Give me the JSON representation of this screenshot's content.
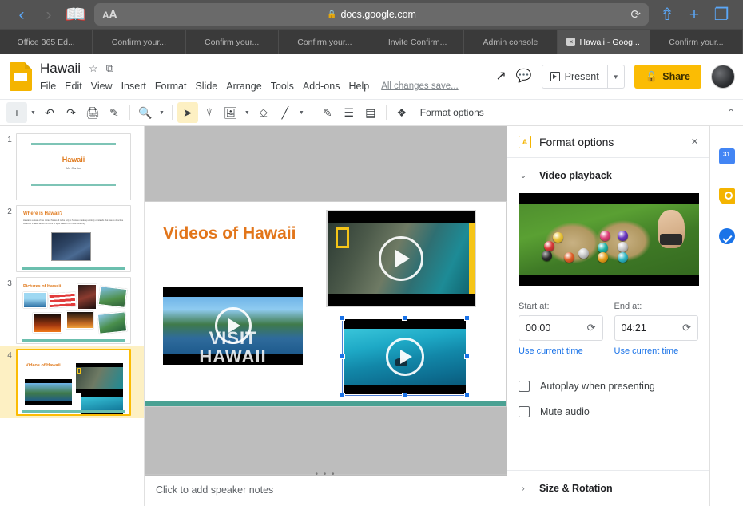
{
  "browser": {
    "back_icon": "chevron-left",
    "forward_icon": "chevron-right",
    "bookmarks_icon": "book",
    "reader_label": "AA",
    "url": "docs.google.com",
    "lock_icon": "lock",
    "reload_icon": "reload",
    "share_icon": "share-up",
    "newtab_icon": "plus",
    "tabs_icon": "tabs",
    "tabs": [
      {
        "label": "Office 365 Ed...",
        "active": false,
        "has_close": false
      },
      {
        "label": "Confirm your...",
        "active": false,
        "has_close": false
      },
      {
        "label": "Confirm your...",
        "active": false,
        "has_close": false
      },
      {
        "label": "Confirm your...",
        "active": false,
        "has_close": false
      },
      {
        "label": "Invite Confirm...",
        "active": false,
        "has_close": false
      },
      {
        "label": "Admin console",
        "active": false,
        "has_close": false
      },
      {
        "label": "Hawaii - Goog...",
        "active": true,
        "has_close": true,
        "close_glyph": "×"
      },
      {
        "label": "Confirm your...",
        "active": false,
        "has_close": false
      }
    ]
  },
  "app": {
    "logo": "google-slides-logo",
    "doc_title": "Hawaii",
    "star_icon": "☆",
    "move_icon": "⧉",
    "menus": [
      "File",
      "Edit",
      "View",
      "Insert",
      "Format",
      "Slide",
      "Arrange",
      "Tools",
      "Add-ons",
      "Help"
    ],
    "save_state": "All changes save...",
    "activity_icon": "trending-up-icon",
    "comments_icon": "comment-icon",
    "present_label": "Present",
    "present_caret": "▼",
    "share_label": "Share",
    "avatar": "user-avatar"
  },
  "toolbar": {
    "new_slide_icon": "+",
    "new_slide_caret": "▼",
    "undo_icon": "↶",
    "redo_icon": "↷",
    "print_icon": "⎙",
    "paint_format_icon": "✐",
    "zoom_icon": "⌕",
    "zoom_caret": "▼",
    "select_icon": "➤",
    "textbox_icon": "T",
    "image_icon": "▣",
    "image_caret": "▼",
    "shape_icon": "◯",
    "line_icon": "╲",
    "line_caret": "▼",
    "pen_icon": "✎",
    "align_icon": "≡",
    "layout_icon": "☷",
    "transition_icon": "✦",
    "format_options_label": "Format options",
    "collapse_icon": "⌃"
  },
  "filmstrip": {
    "slides": [
      {
        "number": "1",
        "title": "Hawaii",
        "subtitle": "Mr. Cantor",
        "current": false
      },
      {
        "number": "2",
        "title": "Where is Hawaii?",
        "current": false
      },
      {
        "number": "3",
        "title": "Pictures of Hawaii",
        "current": false
      },
      {
        "number": "4",
        "title": "Videos of Hawaii",
        "current": true
      }
    ]
  },
  "slide": {
    "title": "Videos of Hawaii",
    "video1_overlay": "VISIT\nHAWAII",
    "video1_name": "visit-hawaii-video",
    "video2_name": "national-geographic-video",
    "video3_name": "surfing-video-selected"
  },
  "notes": {
    "grip_icon": "• • •",
    "placeholder": "Click to add speaker notes"
  },
  "format_panel": {
    "panel_icon": "format-options-icon",
    "title": "Format options",
    "close_icon": "×",
    "sections": [
      {
        "label": "Video playback",
        "expanded": true,
        "chevron": "⌄"
      },
      {
        "label": "Size & Rotation",
        "expanded": false,
        "chevron": "›"
      }
    ],
    "preview_name": "video-thumbnail-preview",
    "start_label": "Start at:",
    "start_value": "00:00",
    "end_label": "End at:",
    "end_value": "04:21",
    "refresh_icon": "⟳",
    "use_current_time": "Use current time",
    "autoplay_label": "Autoplay when presenting",
    "autoplay_checked": false,
    "mute_label": "Mute audio",
    "mute_checked": false
  },
  "right_rail": {
    "items": [
      {
        "name": "google-calendar-icon"
      },
      {
        "name": "google-keep-icon"
      },
      {
        "name": "google-tasks-icon"
      }
    ]
  },
  "colors": {
    "slides_yellow": "#f4b400",
    "share_yellow": "#fbbc04",
    "title_orange": "#e2751a",
    "accent_teal": "#4aa193",
    "link_blue": "#1a73e8",
    "selection_blue": "#1a73e8"
  }
}
